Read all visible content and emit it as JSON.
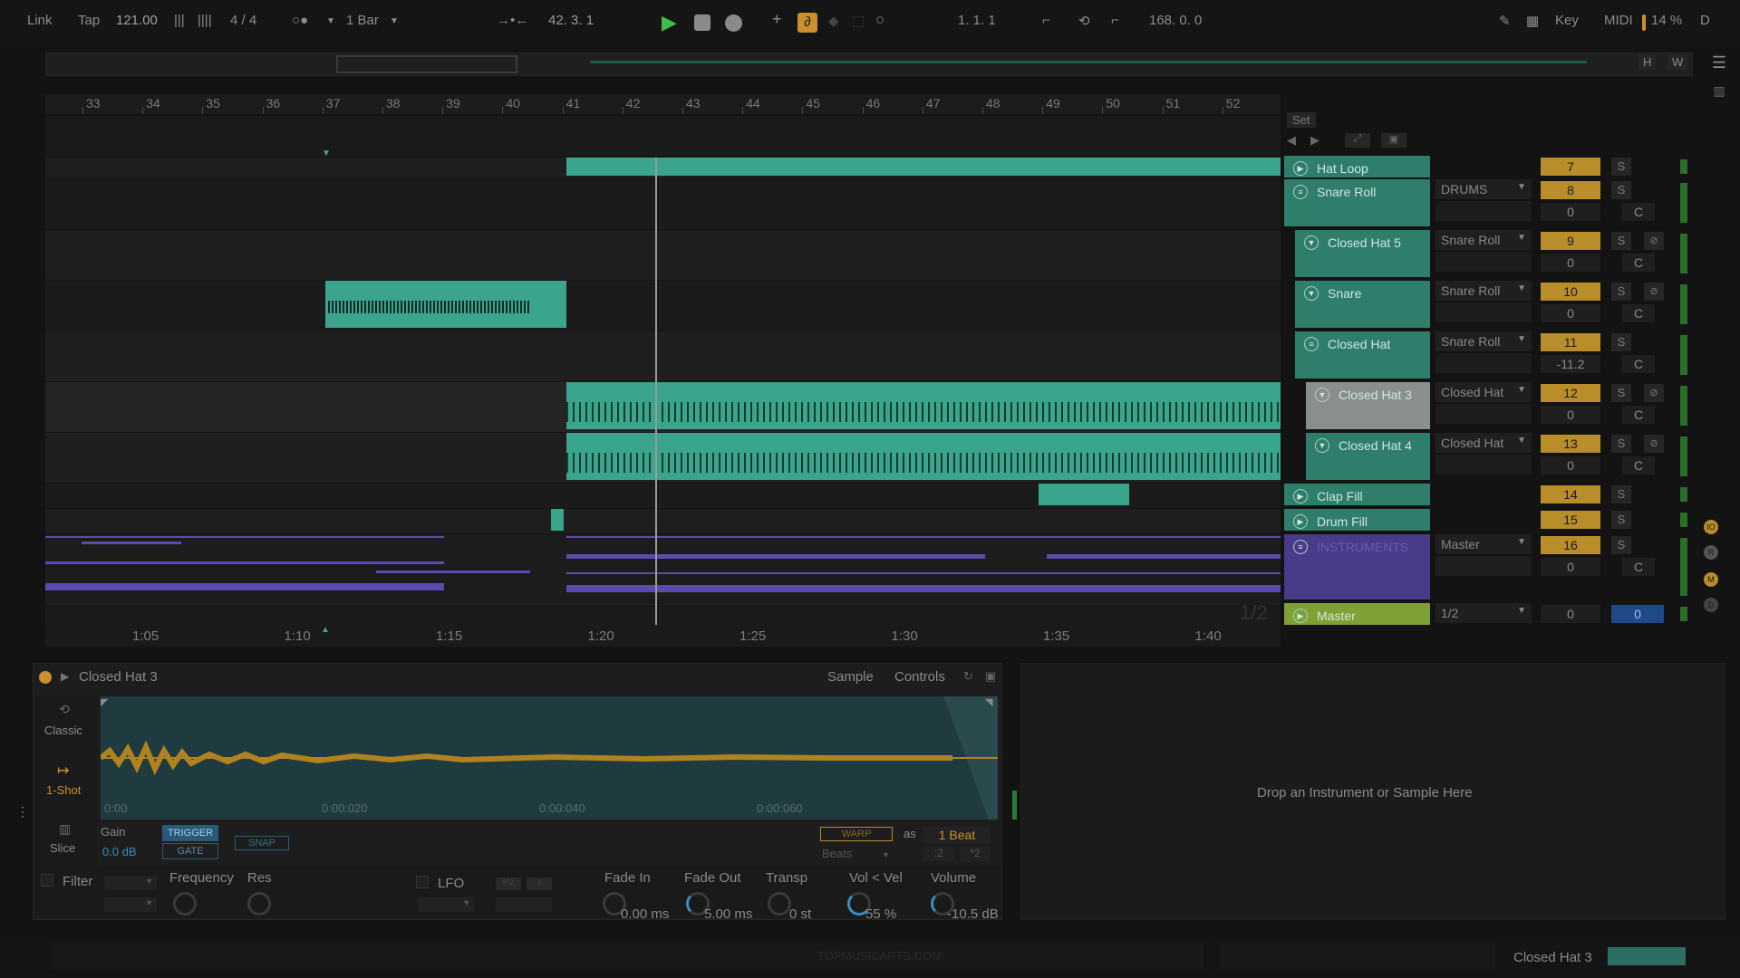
{
  "transport": {
    "link": "Link",
    "tap": "Tap",
    "tempo": "121.00",
    "signature": "4  /  4",
    "quantize": "1 Bar",
    "position": "42.  3.  1",
    "loop_start": "1.  1.  1",
    "loop_length": "168.  0.  0",
    "key": "Key",
    "midi": "MIDI",
    "cpu": "14 %",
    "d": "D"
  },
  "overview": {
    "h": "H",
    "w": "W"
  },
  "ruler": {
    "bars": [
      "33",
      "34",
      "35",
      "36",
      "37",
      "38",
      "39",
      "40",
      "41",
      "42",
      "43",
      "44",
      "45",
      "46",
      "47",
      "48",
      "49",
      "50",
      "51",
      "52"
    ]
  },
  "time_ruler": {
    "marks": [
      "1:05",
      "1:10",
      "1:15",
      "1:20",
      "1:25",
      "1:30",
      "1:35",
      "1:40"
    ]
  },
  "set_label": "Set",
  "page_indicator": "1/2",
  "tracks": [
    {
      "name": "Hat Loop",
      "route": "",
      "num": "7",
      "vol": "",
      "c": ""
    },
    {
      "name": "Snare Roll",
      "route": "DRUMS",
      "num": "8",
      "vol": "0",
      "c": "C"
    },
    {
      "name": "Closed Hat 5",
      "route": "Snare Roll",
      "num": "9",
      "vol": "0",
      "c": "C"
    },
    {
      "name": "Snare",
      "route": "Snare Roll",
      "num": "10",
      "vol": "0",
      "c": "C"
    },
    {
      "name": "Closed Hat",
      "route": "Snare Roll",
      "num": "11",
      "vol": "-11.2",
      "c": "C"
    },
    {
      "name": "Closed Hat 3",
      "route": "Closed Hat",
      "num": "12",
      "vol": "0",
      "c": "C"
    },
    {
      "name": "Closed Hat 4",
      "route": "Closed Hat",
      "num": "13",
      "vol": "0",
      "c": "C"
    },
    {
      "name": "Clap Fill",
      "route": "",
      "num": "14",
      "vol": "",
      "c": ""
    },
    {
      "name": "Drum Fill",
      "route": "",
      "num": "15",
      "vol": "",
      "c": ""
    },
    {
      "name": "INSTRUMENTS",
      "route": "Master",
      "num": "16",
      "vol": "0",
      "c": "C"
    },
    {
      "name": "Master",
      "route": "1/2",
      "num": "0",
      "vol": "0",
      "c": ""
    }
  ],
  "solo_label": "S",
  "device": {
    "title": "Closed Hat 3",
    "tab_sample": "Sample",
    "tab_controls": "Controls",
    "modes": [
      "Classic",
      "1-Shot",
      "Slice"
    ],
    "time_marks": [
      "0:00",
      "0:00:020",
      "0:00:040",
      "0:00:060"
    ],
    "gain_label": "Gain",
    "gain_value": "0.0 dB",
    "trigger": "TRIGGER",
    "gate": "GATE",
    "snap": "SNAP",
    "warp": "WARP",
    "as": "as",
    "beat": "1 Beat",
    "beats_mode": "Beats",
    "div": ":2",
    "mult": "*2",
    "filter": "Filter",
    "frequency": "Frequency",
    "res": "Res",
    "lfo": "LFO",
    "hz": "Hz",
    "fade_in_label": "Fade In",
    "fade_in_value": "0.00 ms",
    "fade_out_label": "Fade Out",
    "fade_out_value": "5.00 ms",
    "transp_label": "Transp",
    "transp_value": "0 st",
    "vel_label": "Vol < Vel",
    "vel_value": "55 %",
    "volume_label": "Volume",
    "volume_value": "-10.5 dB"
  },
  "drop_hint": "Drop an Instrument or Sample Here",
  "status": {
    "watermark": "TOPMUSICARTS.COM",
    "selected": "Closed Hat 3"
  },
  "colors": {
    "clip": "#3aa58c",
    "accent": "#e8a13a",
    "midi_clip": "#5b4bae",
    "master": "#7fa034"
  }
}
